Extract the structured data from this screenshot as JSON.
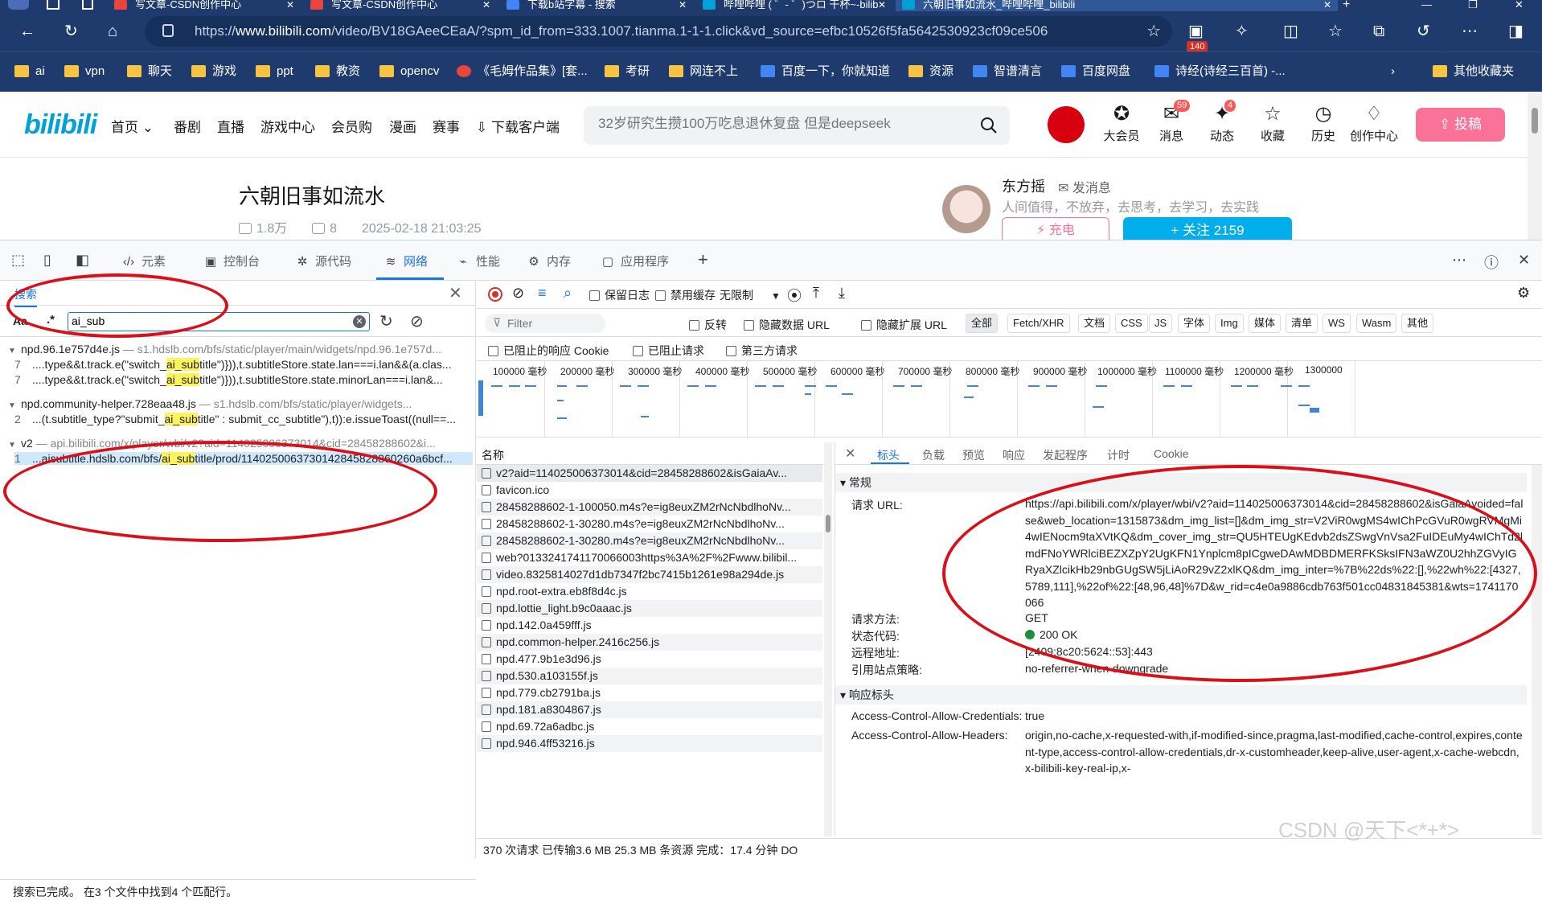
{
  "browser": {
    "tabs": [
      {
        "title": "写文章-CSDN创作中心",
        "color": "#e8453c"
      },
      {
        "title": "写文章-CSDN创作中心",
        "color": "#e8453c"
      },
      {
        "title": "下载b站字幕 - 搜索",
        "color": "#4285f4"
      },
      {
        "title": "哔哩哔哩 ( ゜- ゜)つロ 干杯~-bilib",
        "color": "#00a1d6"
      },
      {
        "title": "六朝旧事如流水_哔哩哔哩_bilibili",
        "color": "#00a1d6"
      }
    ],
    "new_tab": "+",
    "url_prefix": "https://",
    "url_host": "www.bilibili.com",
    "url_rest": "/video/BV18GAeeCEaA/?spm_id_from=333.1007.tianma.1-1-1.click&vd_source=efbc10526f5fa5642530923cf09ce506",
    "ext_badge": "140",
    "bookmarks": [
      {
        "label": "ai",
        "kind": "folder"
      },
      {
        "label": "vpn",
        "kind": "folder"
      },
      {
        "label": "聊天",
        "kind": "folder"
      },
      {
        "label": "游戏",
        "kind": "folder"
      },
      {
        "label": "ppt",
        "kind": "folder"
      },
      {
        "label": "教资",
        "kind": "folder"
      },
      {
        "label": "opencv",
        "kind": "folder"
      },
      {
        "label": "《毛姆作品集》[套...",
        "kind": "site"
      },
      {
        "label": "考研",
        "kind": "folder"
      },
      {
        "label": "网连不上",
        "kind": "folder"
      },
      {
        "label": "百度一下，你就知道",
        "kind": "site"
      },
      {
        "label": "资源",
        "kind": "folder"
      },
      {
        "label": "智谱清言",
        "kind": "site"
      },
      {
        "label": "百度网盘",
        "kind": "site"
      },
      {
        "label": "诗经(诗经三百首) -...",
        "kind": "site"
      },
      {
        "label": "其他收藏夹",
        "kind": "folder"
      }
    ]
  },
  "bili": {
    "logo": "bilibili",
    "nav": [
      "首页 ⌄",
      "番剧",
      "直播",
      "游戏中心",
      "会员购",
      "漫画",
      "赛事",
      "下载客户端"
    ],
    "search_placeholder": "32岁研究生攒100万吃息退休复盘 但是deepseek",
    "header_icons": [
      {
        "label": "大会员",
        "icon": "big-member-icon",
        "glyph": "✪",
        "badge": ""
      },
      {
        "label": "消息",
        "icon": "message-icon",
        "glyph": "✉",
        "badge": "59"
      },
      {
        "label": "动态",
        "icon": "dynamic-icon",
        "glyph": "✦",
        "badge": "4"
      },
      {
        "label": "收藏",
        "icon": "star-icon",
        "glyph": "☆",
        "badge": ""
      },
      {
        "label": "历史",
        "icon": "history-icon",
        "glyph": "◷",
        "badge": ""
      },
      {
        "label": "创作中心",
        "icon": "creator-icon",
        "glyph": "♢",
        "badge": ""
      }
    ],
    "upload_label": "⇪ 投稿",
    "video_title": "六朝旧事如流水",
    "views": "1.8万",
    "danmaku": "8",
    "date": "2025-02-18 21:03:25",
    "up_name": "东方摇",
    "up_msg": "✉ 发消息",
    "up_desc": "人间值得，不放弃，去思考，去学习，去实践",
    "charge_label": "⚡ 充电",
    "follow_label": "+ 关注 2159"
  },
  "devtools": {
    "tabs": [
      {
        "label": "元素",
        "icon": "‹/›"
      },
      {
        "label": "控制台",
        "icon": "▣"
      },
      {
        "label": "源代码",
        "icon": "✲"
      },
      {
        "label": "网络",
        "icon": "≋"
      },
      {
        "label": "性能",
        "icon": "⌁"
      },
      {
        "label": "内存",
        "icon": "⚙"
      },
      {
        "label": "应用程序",
        "icon": "▢"
      }
    ],
    "search": {
      "tab_label": "搜索",
      "opt_case": "Aa",
      "opt_regex": ".*",
      "query": "ai_sub",
      "groups": [
        {
          "file": "npd.96.1e757d4e.js",
          "path": " — s1.hdslb.com/bfs/static/player/main/widgets/npd.96.1e757d...",
          "lines": [
            {
              "ln": "7",
              "pre": "....type&&t.track.e(\"switch_",
              "hit": "ai_sub",
              "post": "title\")})),t.subtitleStore.state.lan===i.lan&&(a.clas..."
            },
            {
              "ln": "7",
              "pre": "....type&&t.track.e(\"switch_",
              "hit": "ai_sub",
              "post": "title\")})),t.subtitleStore.state.minorLan===i.lan&..."
            }
          ]
        },
        {
          "file": "npd.community-helper.728eaa48.js",
          "path": " — s1.hdslb.com/bfs/static/player/widgets...",
          "lines": [
            {
              "ln": "2",
              "pre": "...(t.subtitle_type?\"submit_",
              "hit": "ai_sub",
              "post": "title\" : submit_cc_subtitle\"),t)):e.issueToast((null==..."
            }
          ]
        },
        {
          "file": "v2",
          "path": " — api.bilibili.com/x/player/wbi/v2?aid=114025006373014&cid=28458288602&i...",
          "lines": [
            {
              "ln": "1",
              "pre": "...aisubtitle.hdslb.com/bfs/",
              "hit": "ai_sub",
              "post": "title/prod/1140250063730142845828860260a6bcf..."
            }
          ]
        }
      ],
      "status": "搜索已完成。 在3 个文件中找到4 个匹配行。"
    },
    "network": {
      "toolbar": {
        "preserve_log": "保留日志",
        "disable_cache": "禁用缓存",
        "throttle": "无限制"
      },
      "filter_placeholder": "Filter",
      "invert": "反转",
      "hide_data_url": "隐藏数据 URL",
      "hide_ext_url": "隐藏扩展 URL",
      "types": [
        "全部",
        "Fetch/XHR",
        "文档",
        "CSS",
        "JS",
        "字体",
        "Img",
        "媒体",
        "清单",
        "WS",
        "Wasm",
        "其他"
      ],
      "blocked_cookies": "已阻止的响应 Cookie",
      "blocked_requests": "已阻止请求",
      "third_party": "第三方请求",
      "timeline_ticks": [
        "100000 毫秒",
        "200000 毫秒",
        "300000 毫秒",
        "400000 毫秒",
        "500000 毫秒",
        "600000 毫秒",
        "700000 毫秒",
        "800000 毫秒",
        "900000 毫秒",
        "1000000 毫秒",
        "1100000 毫秒",
        "1200000 毫秒",
        "1300000"
      ],
      "name_header": "名称",
      "requests": [
        "v2?aid=114025006373014&cid=28458288602&isGaiaAv...",
        "favicon.ico",
        "28458288602-1-100050.m4s?e=ig8euxZM2rNcNbdlhoNv...",
        "28458288602-1-30280.m4s?e=ig8euxZM2rNcNbdlhoNv...",
        "28458288602-1-30280.m4s?e=ig8euxZM2rNcNbdlhoNv...",
        "web?0133241741170066003https%3A%2F%2Fwww.bilibil...",
        "video.8325814027d1db7347f2bc7415b1261e98a294de.js",
        "npd.root-extra.eb8f8d4c.js",
        "npd.lottie_light.b9c0aaac.js",
        "npd.142.0a459fff.js",
        "npd.common-helper.2416c256.js",
        "npd.477.9b1e3d96.js",
        "npd.530.a103155f.js",
        "npd.779.cb2791ba.js",
        "npd.181.a8304867.js",
        "npd.69.72a6adbc.js",
        "npd.946.4ff53216.js"
      ],
      "summary": "370 次请求  已传输3.6 MB  25.3 MB 条资源  完成：17.4 分钟  DO",
      "detail_tabs": [
        "标头",
        "负载",
        "预览",
        "响应",
        "发起程序",
        "计时",
        "Cookie"
      ],
      "general_label": "▾ 常规",
      "general": [
        {
          "k": "请求 URL:",
          "v": "https://api.bilibili.com/x/player/wbi/v2?aid=114025006373014&cid=28458288602&isGaiaAvoided=false&web_location=1315873&dm_img_list=[]&dm_img_str=V2ViR0wgMS4wIChPcGVuR0wgRVMgMi4wIENocm9taXVtKQ&dm_cover_img_str=QU5HTEUgKEdvb2dsZSwgVnVsa2FuIDEuMy4wIChTd2lmdFNoYWRlciBEZXZpY2UgKFN1Ynplcm8pICgweDAwMDBDMERFKSksIFN3aWZ0U2hhZGVyIGRyaXZlcikHb29nbGUgSW5jLiAoR29vZ2xlKQ&dm_img_inter=%7B%22ds%22:[],%22wh%22:[4327,5789,111],%22of%22:[48,96,48]%7D&w_rid=c4e0a9886cdb763f501cc04831845381&wts=1741170066"
        },
        {
          "k": "请求方法:",
          "v": "GET"
        },
        {
          "k": "状态代码:",
          "v": "200 OK"
        },
        {
          "k": "远程地址:",
          "v": "[2409:8c20:5624::53]:443"
        },
        {
          "k": "引用站点策略:",
          "v": "no-referrer-when-downgrade"
        }
      ],
      "resp_label": "▾ 响应标头",
      "resp": [
        {
          "k": "Access-Control-Allow-Credentials:",
          "v": "true"
        },
        {
          "k": "Access-Control-Allow-Headers:",
          "v": "origin,no-cache,x-requested-with,if-modified-since,pragma,last-modified,cache-control,expires,content-type,access-control-allow-credentials,dr-x-customheader,keep-alive,user-agent,x-cache-webcdn,x-bilibili-key-real-ip,x-"
        }
      ]
    }
  },
  "watermark": "CSDN @天下<*+*>"
}
